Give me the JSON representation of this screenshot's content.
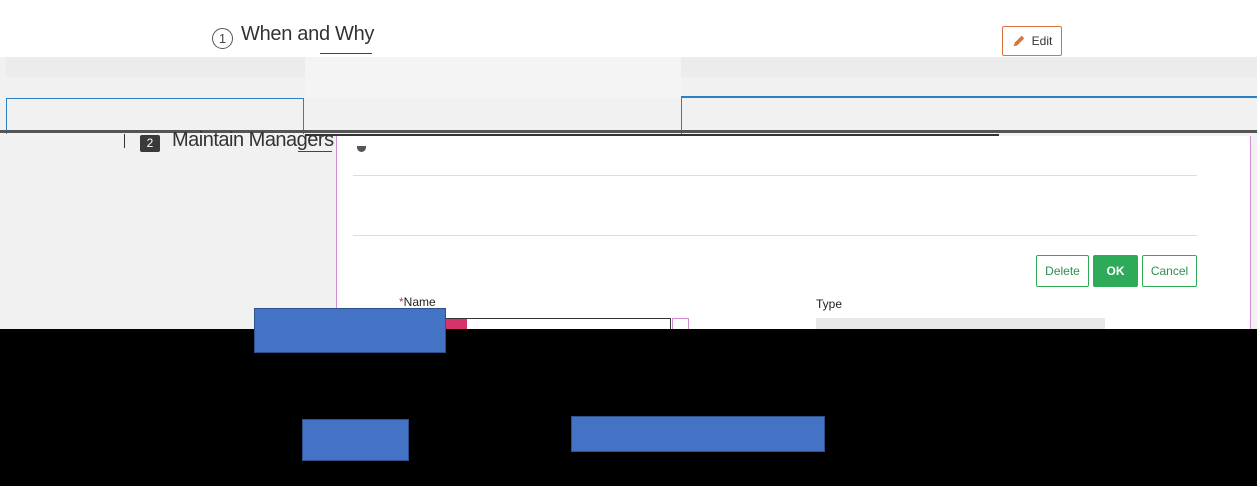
{
  "step1": {
    "number": "1",
    "title": "When and Why",
    "edit_label": "Edit"
  },
  "step2": {
    "number": "2",
    "title": "Maintain Managers"
  },
  "dialog": {
    "buttons": {
      "delete": "Delete",
      "ok": "OK",
      "cancel": "Cancel"
    },
    "fields": {
      "name": {
        "label": "Name",
        "required_marker": "*",
        "value": ""
      },
      "type": {
        "label": "Type",
        "value": ""
      }
    }
  },
  "colors": {
    "accent_green": "#2eab58",
    "panel_blue": "#2e7fc4",
    "edit_border": "#d9743a",
    "redaction_blue": "#4472c4"
  }
}
